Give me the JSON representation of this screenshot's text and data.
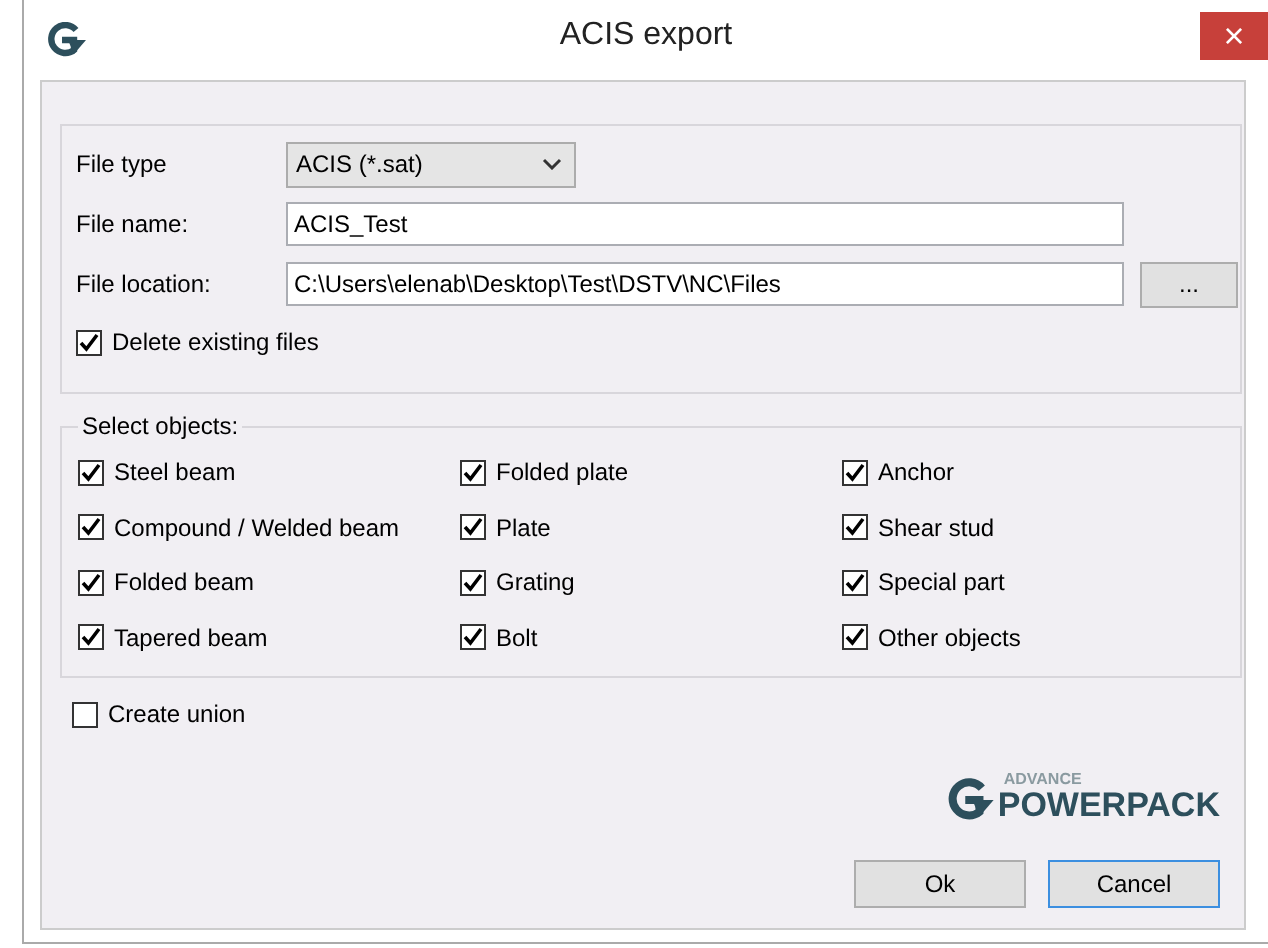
{
  "window": {
    "title": "ACIS export",
    "close": "×"
  },
  "file_type": {
    "label": "File type",
    "value": "ACIS (*.sat)"
  },
  "file_name": {
    "label": "File name:",
    "value": "ACIS_Test"
  },
  "file_location": {
    "label": "File location:",
    "value": "C:\\Users\\elenab\\Desktop\\Test\\DSTV\\NC\\Files",
    "browse": "..."
  },
  "delete_existing": {
    "label": "Delete existing files",
    "checked": true
  },
  "select_objects": {
    "title": "Select objects:",
    "items": [
      {
        "label": "Steel beam",
        "checked": true
      },
      {
        "label": "Folded plate",
        "checked": true
      },
      {
        "label": "Anchor",
        "checked": true
      },
      {
        "label": "Compound / Welded beam",
        "checked": true
      },
      {
        "label": "Plate",
        "checked": true
      },
      {
        "label": "Shear stud",
        "checked": true
      },
      {
        "label": "Folded beam",
        "checked": true
      },
      {
        "label": "Grating",
        "checked": true
      },
      {
        "label": "Special part",
        "checked": true
      },
      {
        "label": "Tapered beam",
        "checked": true
      },
      {
        "label": "Bolt",
        "checked": true
      },
      {
        "label": "Other objects",
        "checked": true
      }
    ]
  },
  "create_union": {
    "label": "Create union",
    "checked": false
  },
  "logo": {
    "small": "ADVANCE",
    "large": "POWERPACK"
  },
  "buttons": [
    {
      "label": "Ok",
      "default": false
    },
    {
      "label": "Cancel",
      "default": true
    }
  ]
}
